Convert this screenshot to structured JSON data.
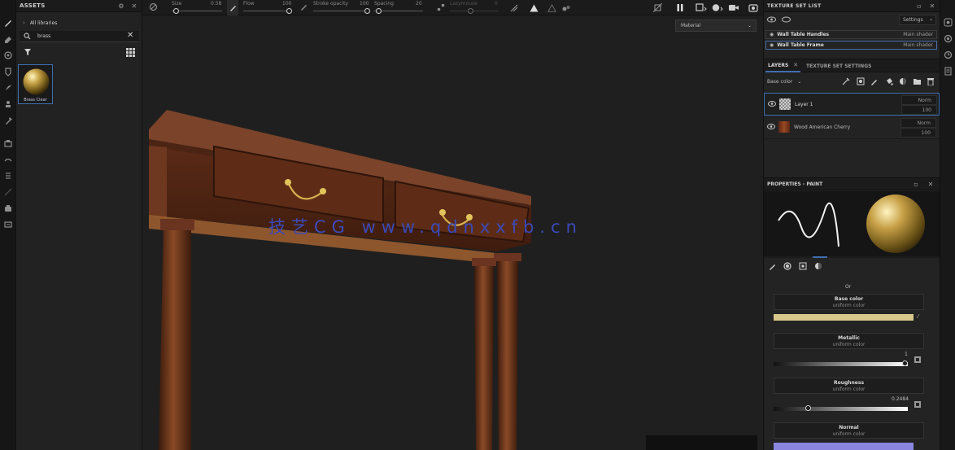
{
  "assets": {
    "title": "ASSETS",
    "breadcrumb": "All libraries",
    "search_value": "brass",
    "thumbnail_label": "Brass Clear"
  },
  "toolbar": {
    "size_label": "Size",
    "size_value": "0.58",
    "flow_label": "Flow",
    "flow_value": "100",
    "stroke_opacity_label": "Stroke opacity",
    "stroke_opacity_value": "100",
    "spacing_label": "Spacing",
    "spacing_value": "20",
    "lazy_label": "Lazymouse",
    "lazy_value": "0"
  },
  "viewport": {
    "display_mode": "Material",
    "watermark": "技艺CG www.qdnxxfb.cn"
  },
  "texture_set_list": {
    "title": "TEXTURE SET LIST",
    "settings_label": "Settings",
    "items": [
      {
        "name": "Wall Table Handles",
        "shader": "Main shader"
      },
      {
        "name": "Wall Table Frame",
        "shader": "Main shader"
      }
    ]
  },
  "layers": {
    "tab_layers": "LAYERS",
    "tab_settings": "TEXTURE SET SETTINGS",
    "channel": "Base color",
    "items": [
      {
        "name": "Layer 1",
        "blend": "Norm",
        "opacity": "100"
      },
      {
        "name": "Wood American Cherry",
        "blend": "Norm",
        "opacity": "100"
      }
    ]
  },
  "properties": {
    "title": "PROPERTIES - PAINT",
    "section_label": "Or",
    "params": [
      {
        "title": "Base color",
        "sub": "uniform color"
      },
      {
        "title": "Metallic",
        "sub": "uniform color",
        "value": "1",
        "level": 1.0
      },
      {
        "title": "Roughness",
        "sub": "uniform color",
        "value": "0.2484",
        "level": 0.2484
      },
      {
        "title": "Normal",
        "sub": "uniform color"
      }
    ]
  },
  "colors": {
    "base_color": "#d8c88a",
    "normal_color": "#8a86e0",
    "watermark": "#3b4ab8",
    "layer_selected": "#3f6fb0"
  }
}
